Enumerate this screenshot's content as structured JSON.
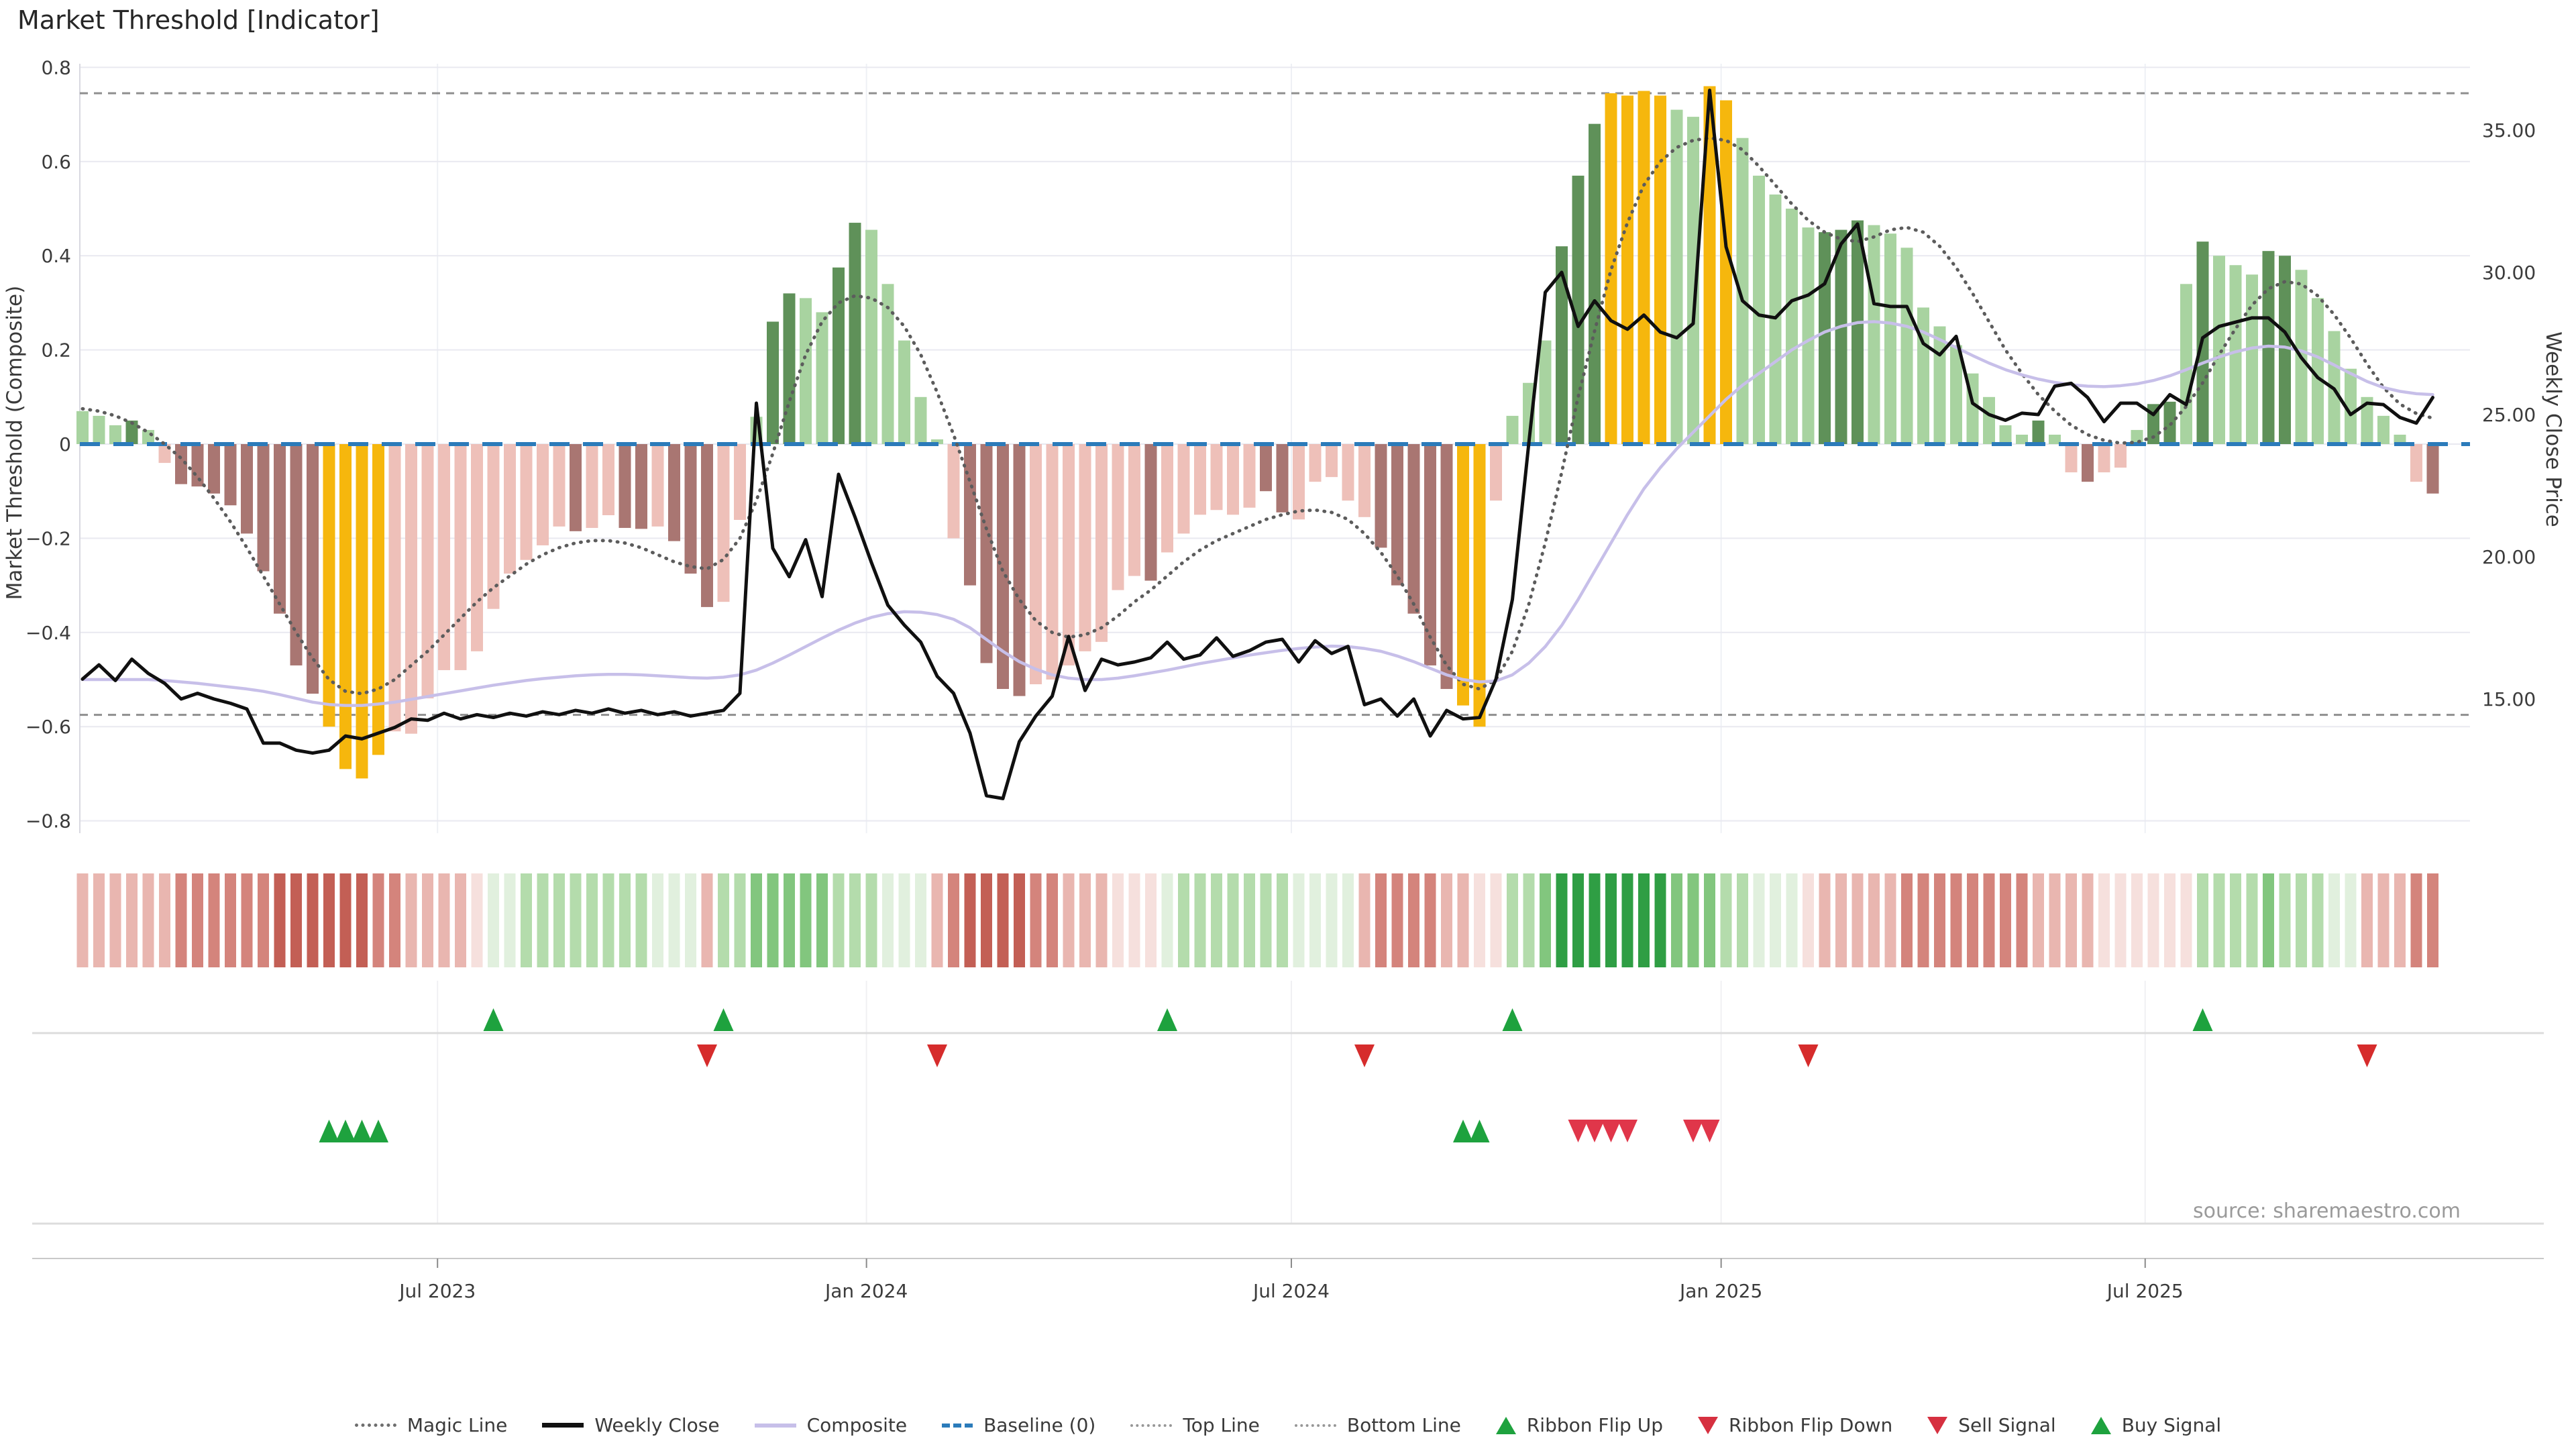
{
  "title": "Market Threshold [Indicator]",
  "source": "source: sharemaestro.com",
  "axes": {
    "left_label": "Market Threshold (Composite)",
    "right_label": "Weekly Close Price",
    "left_ticks": [
      {
        "v": 0.8,
        "label": "0.8"
      },
      {
        "v": 0.6,
        "label": "0.6"
      },
      {
        "v": 0.4,
        "label": "0.4"
      },
      {
        "v": 0.2,
        "label": "0.2"
      },
      {
        "v": 0.0,
        "label": "0"
      },
      {
        "v": -0.2,
        "label": "−0.2"
      },
      {
        "v": -0.4,
        "label": "−0.4"
      },
      {
        "v": -0.6,
        "label": "−0.6"
      },
      {
        "v": -0.8,
        "label": "−0.8"
      }
    ],
    "right_ticks": [
      {
        "p": 35,
        "label": "35.00"
      },
      {
        "p": 30,
        "label": "30.00"
      },
      {
        "p": 25,
        "label": "25.00"
      },
      {
        "p": 20,
        "label": "20.00"
      },
      {
        "p": 15,
        "label": "15.00"
      }
    ],
    "x_ticks": [
      {
        "week": 21.6,
        "label": "Jul 2023"
      },
      {
        "week": 47.7,
        "label": "Jan 2024"
      },
      {
        "week": 73.55,
        "label": "Jul 2024"
      },
      {
        "week": 99.7,
        "label": "Jan 2025"
      },
      {
        "week": 125.5,
        "label": "Jul 2025"
      }
    ]
  },
  "legend": {
    "items": [
      {
        "label": "Magic Line",
        "marker": "dot-gray"
      },
      {
        "label": "Weekly Close",
        "marker": "solid-black"
      },
      {
        "label": "Composite",
        "marker": "solid-purple"
      },
      {
        "label": "Baseline (0)",
        "marker": "dash-blue"
      },
      {
        "label": "Top Line",
        "marker": "dot-fine"
      },
      {
        "label": "Bottom Line",
        "marker": "dot-fine"
      },
      {
        "label": "Ribbon Flip Up",
        "marker": "tri-up"
      },
      {
        "label": "Ribbon Flip Down",
        "marker": "tri-down"
      },
      {
        "label": "Sell Signal",
        "marker": "tri-down"
      },
      {
        "label": "Buy Signal",
        "marker": "tri-up"
      }
    ]
  },
  "chart_data": {
    "type": "bar",
    "subtype": "composite-indicator-panel",
    "title": "Market Threshold [Indicator]",
    "ylabel": "Market Threshold (Composite)",
    "y2label": "Weekly Close Price",
    "ylim": [
      -0.8,
      0.8
    ],
    "y2lim_ticks": [
      15,
      20,
      25,
      30,
      35
    ],
    "top_line": 0.745,
    "bottom_line": -0.575,
    "baseline": 0,
    "grid": true,
    "legend_position": "bottom",
    "bar_palette": {
      "lg": "#a8d3a0",
      "dg": "#5f9159",
      "gg": "#f6b70d",
      "pk": "#eec0b9",
      "dk": "#a97672"
    },
    "ribbon_palette": {
      "r1": "#f6e0dd",
      "r2": "#e9b6b0",
      "r3": "#d4847c",
      "r4": "#c35f55",
      "g1": "#e1f0de",
      "g2": "#b4dcac",
      "g3": "#82c67e",
      "g4": "#2f9e44"
    },
    "line_colors": {
      "weekly_close": "#101010",
      "magic": "#5c5c5c",
      "composite": "#c7bfe9",
      "baseline": "#2b7bba",
      "guides": "#8f8f8f"
    },
    "bar_values": [
      0.07,
      0.06,
      0.04,
      0.05,
      0.03,
      -0.04,
      -0.085,
      -0.09,
      -0.105,
      -0.13,
      -0.19,
      -0.27,
      -0.36,
      -0.47,
      -0.53,
      -0.6,
      -0.69,
      -0.71,
      -0.66,
      -0.61,
      -0.615,
      -0.54,
      -0.48,
      -0.48,
      -0.44,
      -0.35,
      -0.275,
      -0.246,
      -0.215,
      -0.175,
      -0.185,
      -0.178,
      -0.151,
      -0.178,
      -0.18,
      -0.175,
      -0.206,
      -0.275,
      -0.346,
      -0.335,
      -0.161,
      0.058,
      0.26,
      0.32,
      0.31,
      0.28,
      0.375,
      0.47,
      0.455,
      0.34,
      0.22,
      0.1,
      0.01,
      -0.2,
      -0.3,
      -0.465,
      -0.52,
      -0.535,
      -0.51,
      -0.5,
      -0.47,
      -0.44,
      -0.42,
      -0.31,
      -0.28,
      -0.29,
      -0.23,
      -0.19,
      -0.15,
      -0.14,
      -0.15,
      -0.135,
      -0.1,
      -0.145,
      -0.16,
      -0.08,
      -0.07,
      -0.12,
      -0.155,
      -0.22,
      -0.3,
      -0.36,
      -0.47,
      -0.52,
      -0.555,
      -0.6,
      -0.12,
      0.06,
      0.13,
      0.22,
      0.42,
      0.57,
      0.68,
      0.745,
      0.74,
      0.75,
      0.74,
      0.71,
      0.695,
      0.76,
      0.73,
      0.65,
      0.57,
      0.53,
      0.5,
      0.46,
      0.45,
      0.455,
      0.475,
      0.465,
      0.447,
      0.417,
      0.29,
      0.25,
      0.21,
      0.15,
      0.1,
      0.04,
      0.02,
      0.05,
      0.02,
      -0.06,
      -0.08,
      -0.06,
      -0.05,
      0.03,
      0.085,
      0.09,
      0.34,
      0.43,
      0.4,
      0.38,
      0.36,
      0.41,
      0.4,
      0.37,
      0.31,
      0.24,
      0.16,
      0.1,
      0.06,
      0.02,
      -0.08,
      -0.105
    ],
    "bar_colors": [
      "lg",
      "lg",
      "lg",
      "dg",
      "lg",
      "pk",
      "dk",
      "dk",
      "dk",
      "dk",
      "dk",
      "dk",
      "dk",
      "dk",
      "dk",
      "gg",
      "gg",
      "gg",
      "gg",
      "pk",
      "pk",
      "pk",
      "pk",
      "pk",
      "pk",
      "pk",
      "pk",
      "pk",
      "pk",
      "pk",
      "dk",
      "pk",
      "pk",
      "dk",
      "dk",
      "pk",
      "dk",
      "dk",
      "dk",
      "pk",
      "pk",
      "lg",
      "dg",
      "dg",
      "lg",
      "lg",
      "dg",
      "dg",
      "lg",
      "lg",
      "lg",
      "lg",
      "lg",
      "pk",
      "dk",
      "dk",
      "dk",
      "dk",
      "pk",
      "pk",
      "pk",
      "pk",
      "pk",
      "pk",
      "pk",
      "dk",
      "pk",
      "pk",
      "pk",
      "pk",
      "pk",
      "pk",
      "dk",
      "dk",
      "pk",
      "pk",
      "pk",
      "pk",
      "pk",
      "dk",
      "dk",
      "dk",
      "dk",
      "dk",
      "gg",
      "gg",
      "pk",
      "lg",
      "lg",
      "lg",
      "dg",
      "dg",
      "dg",
      "gg",
      "gg",
      "gg",
      "gg",
      "lg",
      "lg",
      "gg",
      "gg",
      "lg",
      "lg",
      "lg",
      "lg",
      "lg",
      "dg",
      "dg",
      "dg",
      "lg",
      "lg",
      "lg",
      "lg",
      "lg",
      "lg",
      "lg",
      "lg",
      "lg",
      "lg",
      "dg",
      "lg",
      "pk",
      "dk",
      "pk",
      "pk",
      "lg",
      "dg",
      "dg",
      "lg",
      "dg",
      "lg",
      "lg",
      "lg",
      "dg",
      "dg",
      "lg",
      "lg",
      "lg",
      "lg",
      "lg",
      "lg",
      "lg",
      "pk",
      "dk"
    ],
    "weekly_close": [
      15.7,
      16.2,
      15.65,
      16.4,
      15.9,
      15.55,
      15.0,
      15.2,
      15.0,
      14.85,
      14.65,
      13.45,
      13.45,
      13.2,
      13.1,
      13.2,
      13.7,
      13.6,
      13.8,
      14.0,
      14.3,
      14.25,
      14.5,
      14.3,
      14.45,
      14.35,
      14.5,
      14.4,
      14.55,
      14.45,
      14.6,
      14.5,
      14.65,
      14.5,
      14.6,
      14.45,
      14.55,
      14.4,
      14.5,
      14.6,
      15.2,
      25.4,
      20.3,
      19.3,
      20.6,
      18.6,
      22.9,
      21.4,
      19.8,
      18.3,
      17.6,
      17.0,
      15.8,
      15.2,
      13.8,
      11.6,
      11.5,
      13.5,
      14.4,
      15.1,
      17.2,
      15.3,
      16.4,
      16.2,
      16.3,
      16.45,
      17.0,
      16.4,
      16.55,
      17.15,
      16.5,
      16.7,
      17.0,
      17.1,
      16.3,
      17.05,
      16.6,
      16.85,
      14.8,
      15.0,
      14.4,
      15.0,
      13.7,
      14.6,
      14.3,
      14.35,
      15.7,
      18.5,
      24.0,
      29.3,
      30.0,
      28.1,
      29.0,
      28.3,
      28.0,
      28.5,
      27.9,
      27.7,
      28.2,
      36.4,
      30.9,
      29.0,
      28.5,
      28.4,
      29.0,
      29.2,
      29.6,
      31.0,
      31.7,
      28.9,
      28.8,
      28.8,
      27.5,
      27.1,
      27.75,
      25.4,
      25.0,
      24.8,
      25.05,
      25.0,
      26.0,
      26.1,
      25.6,
      24.75,
      25.4,
      25.4,
      25.0,
      25.7,
      25.35,
      27.7,
      28.1,
      28.25,
      28.4,
      28.4,
      27.9,
      27.0,
      26.3,
      25.9,
      25.0,
      25.4,
      25.35,
      24.9,
      24.7,
      25.6
    ],
    "magic_line": [
      0.075,
      0.07,
      0.06,
      0.045,
      0.025,
      0.0,
      -0.03,
      -0.07,
      -0.115,
      -0.165,
      -0.22,
      -0.28,
      -0.34,
      -0.4,
      -0.455,
      -0.5,
      -0.525,
      -0.53,
      -0.52,
      -0.5,
      -0.47,
      -0.44,
      -0.405,
      -0.37,
      -0.335,
      -0.305,
      -0.28,
      -0.255,
      -0.235,
      -0.22,
      -0.21,
      -0.205,
      -0.205,
      -0.21,
      -0.22,
      -0.235,
      -0.25,
      -0.26,
      -0.265,
      -0.245,
      -0.2,
      -0.12,
      -0.02,
      0.09,
      0.19,
      0.26,
      0.3,
      0.315,
      0.31,
      0.29,
      0.25,
      0.19,
      0.11,
      0.02,
      -0.08,
      -0.18,
      -0.27,
      -0.33,
      -0.375,
      -0.4,
      -0.41,
      -0.405,
      -0.39,
      -0.365,
      -0.335,
      -0.31,
      -0.28,
      -0.25,
      -0.225,
      -0.205,
      -0.19,
      -0.175,
      -0.16,
      -0.15,
      -0.142,
      -0.14,
      -0.145,
      -0.16,
      -0.19,
      -0.23,
      -0.28,
      -0.34,
      -0.41,
      -0.47,
      -0.51,
      -0.52,
      -0.5,
      -0.44,
      -0.34,
      -0.21,
      -0.06,
      0.1,
      0.24,
      0.37,
      0.47,
      0.55,
      0.6,
      0.63,
      0.645,
      0.65,
      0.645,
      0.625,
      0.59,
      0.55,
      0.51,
      0.475,
      0.45,
      0.435,
      0.43,
      0.44,
      0.455,
      0.46,
      0.45,
      0.42,
      0.375,
      0.32,
      0.26,
      0.2,
      0.15,
      0.105,
      0.07,
      0.04,
      0.02,
      0.008,
      0.002,
      0.004,
      0.015,
      0.04,
      0.08,
      0.13,
      0.19,
      0.245,
      0.295,
      0.33,
      0.345,
      0.34,
      0.315,
      0.275,
      0.225,
      0.17,
      0.12,
      0.085,
      0.065,
      0.055
    ],
    "composite_line": [
      -0.5,
      -0.5,
      -0.5,
      -0.5,
      -0.5,
      -0.502,
      -0.505,
      -0.508,
      -0.512,
      -0.516,
      -0.52,
      -0.525,
      -0.532,
      -0.54,
      -0.548,
      -0.553,
      -0.555,
      -0.555,
      -0.552,
      -0.548,
      -0.542,
      -0.536,
      -0.53,
      -0.524,
      -0.518,
      -0.512,
      -0.507,
      -0.502,
      -0.498,
      -0.495,
      -0.492,
      -0.49,
      -0.489,
      -0.489,
      -0.49,
      -0.492,
      -0.494,
      -0.496,
      -0.497,
      -0.495,
      -0.49,
      -0.48,
      -0.465,
      -0.448,
      -0.43,
      -0.412,
      -0.395,
      -0.38,
      -0.368,
      -0.36,
      -0.356,
      -0.357,
      -0.362,
      -0.372,
      -0.39,
      -0.415,
      -0.44,
      -0.462,
      -0.478,
      -0.49,
      -0.497,
      -0.5,
      -0.5,
      -0.497,
      -0.492,
      -0.486,
      -0.48,
      -0.473,
      -0.466,
      -0.46,
      -0.454,
      -0.448,
      -0.443,
      -0.438,
      -0.434,
      -0.431,
      -0.429,
      -0.43,
      -0.434,
      -0.44,
      -0.45,
      -0.462,
      -0.476,
      -0.49,
      -0.5,
      -0.505,
      -0.503,
      -0.49,
      -0.465,
      -0.43,
      -0.385,
      -0.33,
      -0.27,
      -0.21,
      -0.15,
      -0.095,
      -0.05,
      -0.01,
      0.025,
      0.06,
      0.095,
      0.125,
      0.15,
      0.175,
      0.2,
      0.22,
      0.238,
      0.25,
      0.258,
      0.26,
      0.257,
      0.25,
      0.238,
      0.222,
      0.205,
      0.188,
      0.172,
      0.158,
      0.147,
      0.138,
      0.131,
      0.126,
      0.123,
      0.122,
      0.124,
      0.128,
      0.135,
      0.145,
      0.158,
      0.172,
      0.185,
      0.196,
      0.204,
      0.208,
      0.206,
      0.198,
      0.185,
      0.168,
      0.15,
      0.133,
      0.12,
      0.112,
      0.107,
      0.105
    ],
    "ribbon": [
      "r2",
      "r2",
      "r2",
      "r2",
      "r2",
      "r2",
      "r3",
      "r3",
      "r3",
      "r3",
      "r3",
      "r3",
      "r4",
      "r4",
      "r4",
      "r4",
      "r4",
      "r4",
      "r3",
      "r3",
      "r2",
      "r2",
      "r2",
      "r2",
      "r1",
      "g1",
      "g1",
      "g2",
      "g2",
      "g2",
      "g2",
      "g2",
      "g2",
      "g2",
      "g2",
      "g1",
      "g1",
      "g1",
      "r2",
      "g2",
      "g2",
      "g3",
      "g3",
      "g3",
      "g3",
      "g3",
      "g2",
      "g2",
      "g2",
      "g1",
      "g1",
      "g1",
      "r2",
      "r3",
      "r4",
      "r4",
      "r4",
      "r4",
      "r3",
      "r3",
      "r2",
      "r2",
      "r2",
      "r1",
      "r1",
      "r1",
      "g1",
      "g2",
      "g2",
      "g2",
      "g2",
      "g2",
      "g2",
      "g2",
      "g1",
      "g1",
      "g1",
      "g1",
      "r2",
      "r3",
      "r3",
      "r3",
      "r3",
      "r2",
      "r2",
      "r1",
      "r1",
      "g2",
      "g2",
      "g3",
      "g4",
      "g4",
      "g4",
      "g4",
      "g4",
      "g4",
      "g4",
      "g3",
      "g3",
      "g3",
      "g2",
      "g2",
      "g1",
      "g1",
      "g1",
      "r1",
      "r2",
      "r2",
      "r2",
      "r2",
      "r2",
      "r3",
      "r3",
      "r3",
      "r3",
      "r3",
      "r3",
      "r3",
      "r3",
      "r2",
      "r2",
      "r2",
      "r2",
      "r1",
      "r1",
      "r1",
      "r1",
      "r1",
      "r1",
      "g2",
      "g2",
      "g2",
      "g2",
      "g3",
      "g2",
      "g2",
      "g2",
      "g1",
      "g1",
      "r2",
      "r2",
      "r2",
      "r3",
      "r3"
    ],
    "signals": {
      "ribbon_flip_up_weeks": [
        25,
        39,
        66,
        87,
        129
      ],
      "ribbon_flip_down_weeks": [
        38,
        52,
        78,
        105,
        139
      ],
      "buy_weeks": [
        15,
        16,
        17,
        18,
        84,
        85
      ],
      "sell_weeks": [
        91,
        92,
        93,
        94,
        98,
        99
      ]
    }
  }
}
